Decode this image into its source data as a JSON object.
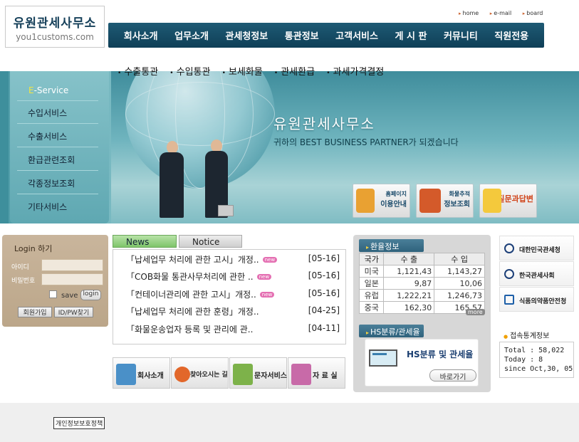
{
  "logo": {
    "korean": "유원관세사무소",
    "english": "you1customs.com"
  },
  "top_links": [
    "home",
    "e-mail",
    "board"
  ],
  "main_nav": [
    "회사소개",
    "업무소개",
    "관세청정보",
    "통관정보",
    "고객서비스",
    "게 시 판",
    "커뮤니티",
    "직원전용"
  ],
  "sub_nav": [
    "수출통관",
    "수입통관",
    "보세화물",
    "관세환급",
    "과세가격결정"
  ],
  "eservice": {
    "title_highlight": "E",
    "title_rest": "-Service",
    "items": [
      "수입서비스",
      "수출서비스",
      "환급관련조회",
      "각종정보조회",
      "기타서비스"
    ]
  },
  "banner": {
    "title": "유원관세사무소",
    "subtitle": "귀하의 BEST BUSINESS PARTNER가 되겠습니다",
    "buttons": [
      {
        "line1": "홈페이지",
        "line2": "이용안내"
      },
      {
        "line1": "화물추적",
        "line2": "정보조회"
      },
      {
        "line1": "질문과답변",
        "line2": ""
      }
    ]
  },
  "login": {
    "title": "Login 하기",
    "id_label": "아이디",
    "pw_label": "비밀번호",
    "save_label": "save",
    "login_button": "login",
    "join_button": "회원가입",
    "find_button": "ID/PW찾기"
  },
  "news": {
    "tabs": [
      "News",
      "Notice"
    ],
    "badge": "new",
    "items": [
      {
        "title": "「납세업무 처리에 관한 고시」개정..",
        "date": "[05-16]",
        "new": true
      },
      {
        "title": "「COB화물 통관사무처리에 관한 ..",
        "date": "[05-16]",
        "new": true
      },
      {
        "title": "「컨테이너관리에 관한 고시」개정..",
        "date": "[05-16]",
        "new": true
      },
      {
        "title": "「납세업무 처리에 관한 훈령」개정..",
        "date": "[04-25]",
        "new": false
      },
      {
        "title": "「화물운송업자 등록 및 관리에 관..",
        "date": "[04-11]",
        "new": false
      }
    ]
  },
  "link_buttons": [
    "회사소개",
    "찾아오시는 길",
    "문자서비스",
    "자 료 실"
  ],
  "exchange": {
    "title": "환율정보",
    "headers": [
      "국가",
      "수 출",
      "수 입"
    ],
    "rows": [
      [
        "미국",
        "1,121,43",
        "1,143,27"
      ],
      [
        "일본",
        "9,87",
        "10,06"
      ],
      [
        "유럽",
        "1,222,21",
        "1,246,73"
      ],
      [
        "중국",
        "162,30",
        "165,57"
      ]
    ],
    "more": "more"
  },
  "hs": {
    "title": "HS분류/관세율",
    "box_title": "HS분류 및 관세율",
    "button": "바로가기"
  },
  "orgs": [
    "대한민국관세청",
    "한국관세사회",
    "식품의약품안전청"
  ],
  "stats": {
    "title": "접속통계정보",
    "total": "Total : 58,022",
    "today": "Today : 8",
    "since": "since Oct,30, 05"
  },
  "footer": {
    "privacy": "개인정보보호정책"
  }
}
